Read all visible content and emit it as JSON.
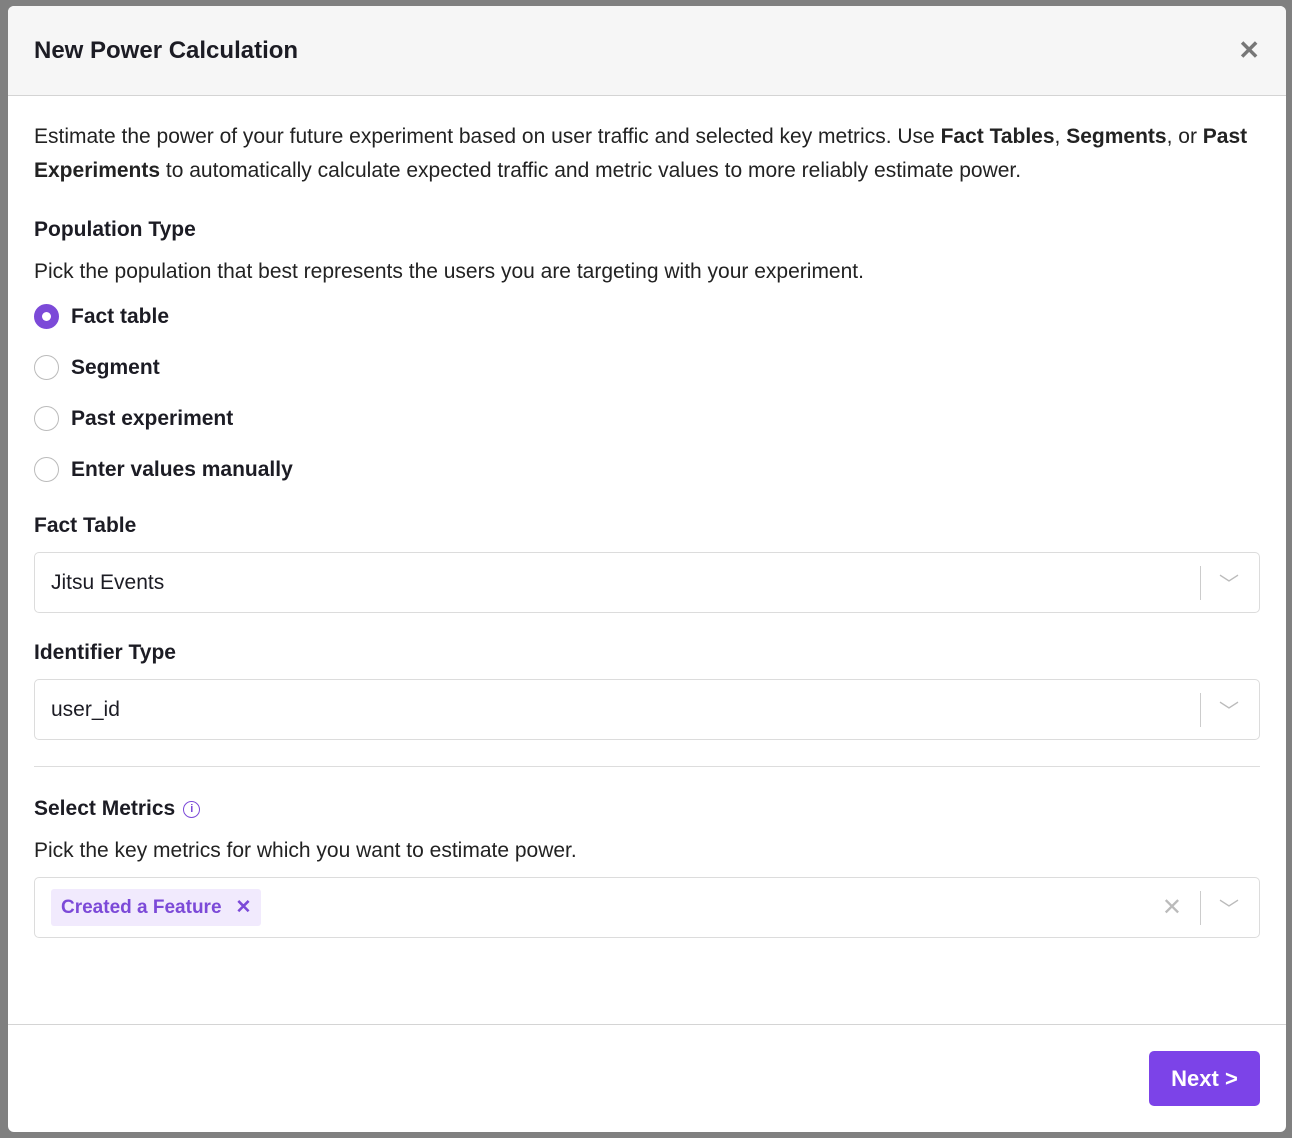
{
  "modal": {
    "title": "New Power Calculation",
    "close_icon": "close-icon"
  },
  "intro": {
    "p1": "Estimate the power of your future experiment based on user traffic and selected key metrics. Use ",
    "b1": "Fact Tables",
    ",": ",",
    "sep1": ", ",
    "b2": "Segments",
    "p2": ", or ",
    "b3": "Past Experiments",
    "p3": " to automatically calculate expected traffic and metric values to more reliably estimate power."
  },
  "population": {
    "label": "Population Type",
    "description": "Pick the population that best represents the users you are targeting with your experiment.",
    "options": [
      {
        "label": "Fact table",
        "selected": true
      },
      {
        "label": "Segment",
        "selected": false
      },
      {
        "label": "Past experiment",
        "selected": false
      },
      {
        "label": "Enter values manually",
        "selected": false
      }
    ]
  },
  "fact_table": {
    "label": "Fact Table",
    "value": "Jitsu Events"
  },
  "identifier": {
    "label": "Identifier Type",
    "value": "user_id"
  },
  "metrics": {
    "label": "Select Metrics",
    "description": "Pick the key metrics for which you want to estimate power.",
    "selected": [
      "Created a Feature"
    ]
  },
  "footer": {
    "next_label": "Next >"
  },
  "colors": {
    "accent": "#7c43e8",
    "chip_bg": "#f1eafd"
  }
}
